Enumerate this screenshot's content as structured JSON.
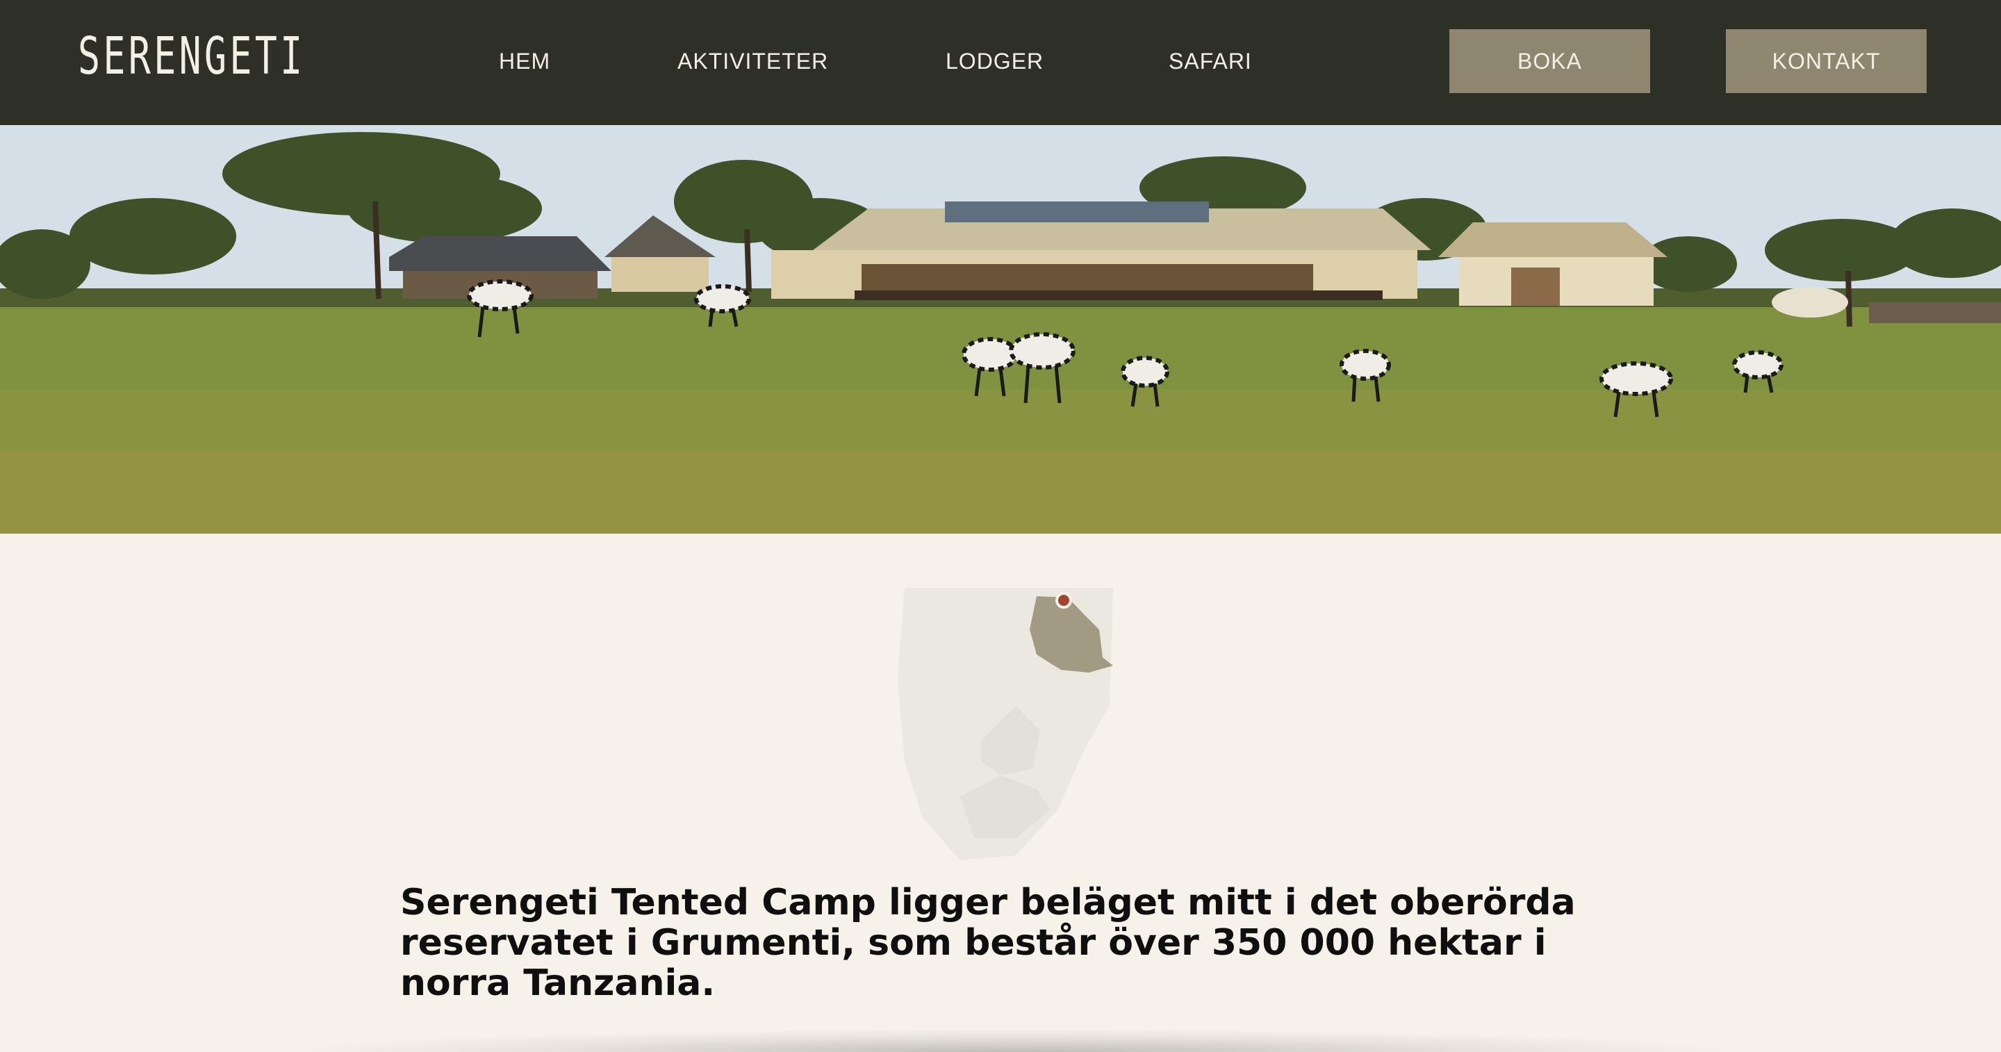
{
  "brand": {
    "logo_text": "SERENGETI"
  },
  "nav": {
    "links": [
      {
        "label": "HEM"
      },
      {
        "label": "AKTIVITETER"
      },
      {
        "label": "LODGER"
      },
      {
        "label": "SAFARI"
      }
    ],
    "book_label": "BOKA",
    "contact_label": "KONTAKT"
  },
  "hero": {
    "image_alt": ""
  },
  "map": {
    "marker_color": "#a4432f",
    "highlight_color": "#a39a84"
  },
  "intro": {
    "text": "Serengeti Tented Camp ligger beläget mitt i det oberörda reservatet i Grumenti, som består över 350 000 hektar i norra Tanzania."
  },
  "colors": {
    "nav_bg": "#2f3025",
    "button_bg": "#8f8670",
    "page_bg": "#f6f2ea"
  }
}
